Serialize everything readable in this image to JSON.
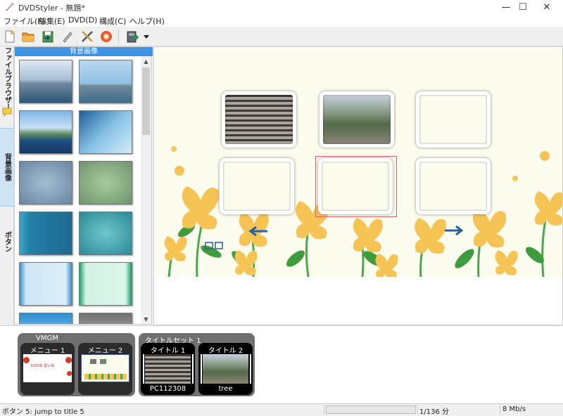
{
  "window": {
    "title": "DVDStyler - 無題*",
    "minimize_glyph": "—",
    "maximize_glyph": "☐",
    "close_glyph": "✕"
  },
  "menu": [
    "ファイル(F)",
    "編集(E)",
    "DVD(D)",
    "構成(C)",
    "ヘルプ(H)"
  ],
  "toolbar": {
    "icons": [
      "new-file-icon",
      "open-folder-icon",
      "save-icon",
      "settings-icon",
      "tools-icon",
      "burn-disc-icon",
      "add-file-icon",
      "dropdown-arrow-icon"
    ]
  },
  "sidetabs": {
    "file_browser": "ファイルブラウザー",
    "background": "背景画像",
    "buttons": "ボタン"
  },
  "panel": {
    "header": "背景画像"
  },
  "tree": {
    "vmgm_label": "VMGM",
    "titleset_label": "タイトルセット 1",
    "menus": [
      {
        "label": "メニュー 1"
      },
      {
        "label": "メニュー 2"
      }
    ],
    "titles": [
      {
        "label": "タイトル 1",
        "caption": "PC112308"
      },
      {
        "label": "タイトル 2",
        "caption": "tree"
      }
    ],
    "menu1_text": "1000年 思い出"
  },
  "status": {
    "message": "ボタン 5: jump to title 5",
    "duration": "1/136 分",
    "rate": "8 Mb/s"
  },
  "colors": {
    "accent": "#3b94e8",
    "menu_bg": "#fdfdef",
    "flower": "#f6c454",
    "leaf": "#4aa84a",
    "selection": "#e06060"
  }
}
